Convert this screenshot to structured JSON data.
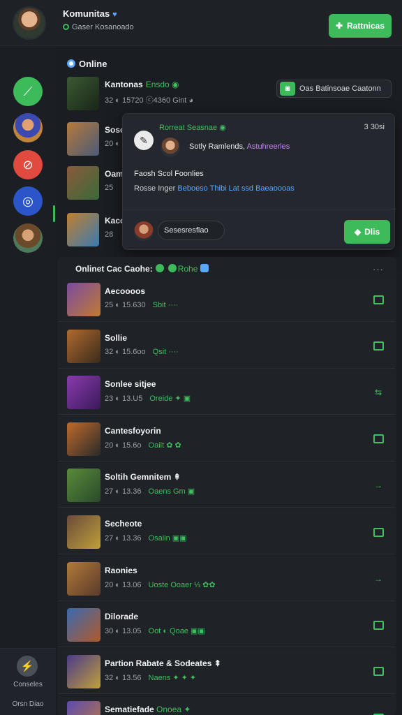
{
  "header": {
    "user_name": "Komunitas",
    "status": "Gaser Kosanoado",
    "primary_button": "Rattnicas",
    "primary_button_icon": "✚"
  },
  "sidebar": {
    "items": [
      {
        "name": "trend",
        "icon": "⟋",
        "color": "#3dbb5b"
      },
      {
        "name": "hero",
        "icon": "",
        "color": "#c0843a"
      },
      {
        "name": "pin",
        "icon": "⊘",
        "color": "#e04a3f"
      },
      {
        "name": "globe",
        "icon": "◎",
        "color": "#2b55c8"
      },
      {
        "name": "ranger",
        "icon": "",
        "color": "#4e7a5a"
      }
    ],
    "bottom_icon": "⚡",
    "bottom_label1": "Conseles",
    "bottom_label2": "Orsn Diao"
  },
  "online": {
    "heading": "Online",
    "rows": [
      {
        "title": "Kantonas",
        "tag": "Ensdo ◉",
        "meta": "32 ◐ 15720  ⓒ4360 Gint ◕",
        "colors": [
          "#3a5a32",
          "#1a2518"
        ]
      },
      {
        "title": "Soso",
        "tag": "",
        "meta": "20 ◐",
        "colors": [
          "#b77a3a",
          "#4a5a78"
        ]
      },
      {
        "title": "Oam",
        "tag": "",
        "meta": "25",
        "colors": [
          "#8a5a3a",
          "#3a6a3a"
        ]
      },
      {
        "title": "Kaco",
        "tag": "",
        "meta": "28",
        "colors": [
          "#c08030",
          "#3a7ab0"
        ]
      }
    ],
    "pill": {
      "label": "Oas Batinsoae Caatonn",
      "icon": "◙"
    }
  },
  "popup": {
    "title": "Rorreat Seasnae ◉",
    "time": "3  30si",
    "subject_lead": "Sotly Ramlends,",
    "subject_highlight": "Astuhreerles",
    "body1": "Faosh Scol Foonlies",
    "body2_lead": "Rosse Inger",
    "body2_link": "Beboeso Thibi Lat ssd Baeaoooas",
    "input_label": "Sesesresflao",
    "button_label": "Dlis",
    "button_icon": "◆"
  },
  "list": {
    "heading": "Onlinet Cac Caohe:",
    "heading_tag": "Rohe",
    "rows": [
      {
        "title": "Aecoooos",
        "tag": "",
        "meta": "25 ◐ 15.630",
        "status": "Sbit ····",
        "action": "box",
        "colors": [
          "#7a4aa0",
          "#c07a30"
        ]
      },
      {
        "title": "Sollie",
        "tag": "",
        "meta": "32 ◐ 15.6oo",
        "status": "Qsit ····",
        "action": "box",
        "colors": [
          "#b06a30",
          "#3a2a1a"
        ]
      },
      {
        "title": "Sonlee sitjee",
        "tag": "",
        "meta": "23 ◐ 13.U5",
        "status": "Oreide ✦ ▣",
        "action": "⇆",
        "colors": [
          "#8a3ab0",
          "#3a1a5a"
        ]
      },
      {
        "title": "Cantesfoyorin",
        "tag": "",
        "meta": "20 ◐ 15.6o",
        "status": "Oaiit ✿ ✿",
        "action": "box",
        "colors": [
          "#c06a2a",
          "#2a2a2a"
        ]
      },
      {
        "title": "Soltih Gemnitem ⇞",
        "tag": "",
        "meta": "27 ◐ 13.36",
        "status": "Oaens Gm ▣",
        "action": "→",
        "colors": [
          "#5a8a3a",
          "#2a4a2a"
        ]
      },
      {
        "title": "Secheote",
        "tag": "",
        "meta": "27 ◐ 13.36",
        "status": "Osaiin ▣▣",
        "action": "box",
        "colors": [
          "#6a4a3a",
          "#c0a03a"
        ]
      },
      {
        "title": "Raonies",
        "tag": "",
        "meta": "20 ◐ 13.06",
        "status": "Uoste Ooaer ⅓ ✿✿",
        "action": "→",
        "colors": [
          "#b07a3a",
          "#5a3a2a"
        ]
      },
      {
        "title": "Dilorade",
        "tag": "",
        "meta": "30 ◐ 13.05",
        "status": "Oot ◐  Qoae ▣▣",
        "action": "box",
        "colors": [
          "#3a6ab0",
          "#b05a2a"
        ]
      },
      {
        "title": "Partion Rabate & Sodeates ⇞",
        "tag": "",
        "meta": "32 ◐ 13.56",
        "status": "Naens ✦ ✦ ✦",
        "action": "box",
        "colors": [
          "#4a3a8a",
          "#c0a03a"
        ]
      },
      {
        "title": "Sematiefade",
        "tag": "Onoea ✦",
        "meta": "",
        "status": "",
        "action": "box",
        "colors": [
          "#5a4ab0",
          "#c07a3a"
        ]
      }
    ]
  }
}
